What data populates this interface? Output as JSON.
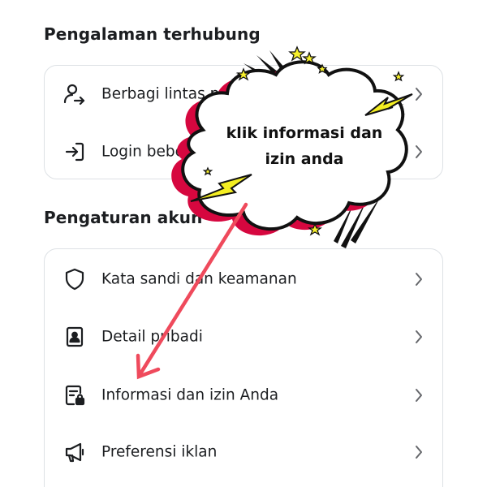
{
  "sections": {
    "connected": {
      "title": "Pengalaman terhubung",
      "items": [
        {
          "label": "Berbagi lintas profil",
          "icon": "share-profile-icon"
        },
        {
          "label": "Login beberapa akun",
          "icon": "login-icon"
        }
      ]
    },
    "account": {
      "title": "Pengaturan akun",
      "items": [
        {
          "label": "Kata sandi dan keamanan",
          "icon": "shield-icon"
        },
        {
          "label": "Detail pribadi",
          "icon": "id-card-icon"
        },
        {
          "label": "Informasi dan izin Anda",
          "icon": "info-lock-icon"
        },
        {
          "label": "Preferensi iklan",
          "icon": "megaphone-icon"
        }
      ]
    }
  },
  "callout": {
    "line1": "klik informasi dan",
    "line2": "izin anda"
  },
  "colors": {
    "arrow": "#ef4a5c",
    "burst_shadow": "#d6073f",
    "bolt": "#f4ee22",
    "star": "#f7f02b",
    "text": "#1c1e21",
    "card_border": "#dde1e5"
  }
}
